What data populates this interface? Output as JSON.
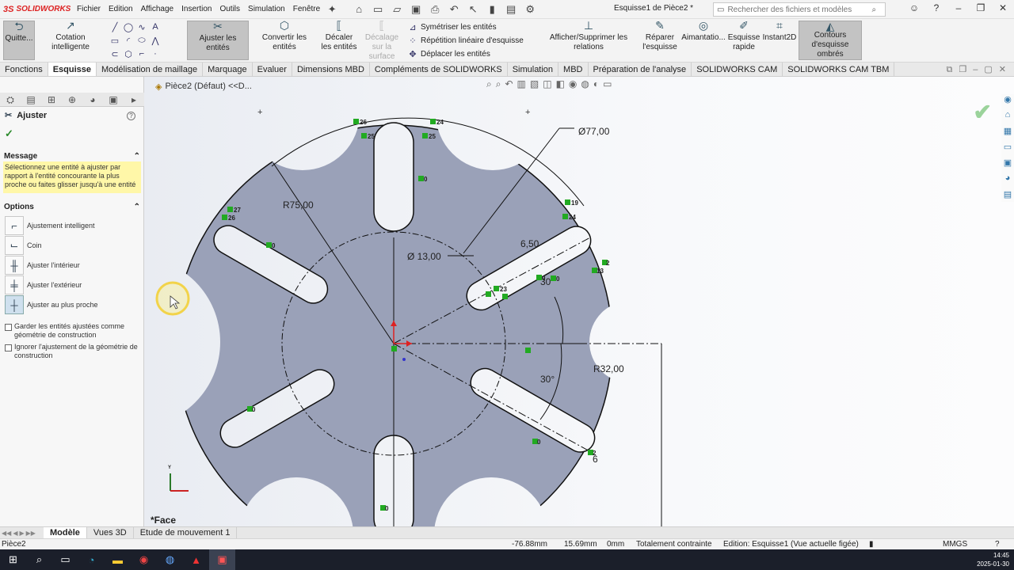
{
  "app": {
    "logo_text": "SOLIDWORKS",
    "menu": [
      "Fichier",
      "Edition",
      "Affichage",
      "Insertion",
      "Outils",
      "Simulation",
      "Fenêtre"
    ],
    "document_title": "Esquisse1 de Pièce2 *",
    "search_placeholder": "Rechercher des fichiers et modèles"
  },
  "ribbon": {
    "quit_label": "Quitte...",
    "smart_dim_label": "Cotation intelligente",
    "trim_label": "Ajuster les entités",
    "convert_label": "Convertir les entités",
    "offset_label": "Décaler les entités",
    "offset_surface_label": "Décalage sur la surface",
    "mirror_label": "Symétriser les entités",
    "linear_pattern_label": "Répétition linéaire d'esquisse",
    "move_label": "Déplacer les entités",
    "relations_label": "Afficher/Supprimer les relations",
    "repair_label": "Réparer l'esquisse",
    "snap_label": "Aimantatio...",
    "quick_sketch_label": "Esquisse rapide",
    "instant2d_label": "Instant2D",
    "shaded_contours_label": "Contours d'esquisse ombrés"
  },
  "tabs": [
    {
      "label": "Fonctions",
      "active": false
    },
    {
      "label": "Esquisse",
      "active": true
    },
    {
      "label": "Modélisation de maillage",
      "active": false
    },
    {
      "label": "Marquage",
      "active": false
    },
    {
      "label": "Evaluer",
      "active": false
    },
    {
      "label": "Dimensions MBD",
      "active": false
    },
    {
      "label": "Compléments de SOLIDWORKS",
      "active": false
    },
    {
      "label": "Simulation",
      "active": false
    },
    {
      "label": "MBD",
      "active": false
    },
    {
      "label": "Préparation de l'analyse",
      "active": false
    },
    {
      "label": "SOLIDWORKS CAM",
      "active": false
    },
    {
      "label": "SOLIDWORKS CAM TBM",
      "active": false
    }
  ],
  "property_manager": {
    "title": "Ajuster",
    "message_header": "Message",
    "message_text": "Sélectionnez une entité à ajuster par rapport à l'entité concourante la plus proche ou faites glisser jusqu'à une entité",
    "options_header": "Options",
    "options": [
      {
        "label": "Ajustement intelligent",
        "icon": "smart-trim-icon",
        "selected": false
      },
      {
        "label": "Coin",
        "icon": "corner-icon",
        "selected": false
      },
      {
        "label": "Ajuster l'intérieur",
        "icon": "trim-inside-icon",
        "selected": false
      },
      {
        "label": "Ajuster l'extérieur",
        "icon": "trim-outside-icon",
        "selected": false
      },
      {
        "label": "Ajuster au plus proche",
        "icon": "trim-closest-icon",
        "selected": true
      }
    ],
    "checkbox_keep_construction": "Garder les entités ajustées comme géométrie de construction",
    "checkbox_ignore_trim": "Ignorer l'ajustement de la géométrie de construction"
  },
  "viewport": {
    "breadcrumb": "Pièce2 (Défaut) <<D...",
    "face_label": "*Face",
    "dimensions": {
      "dia_outer": "Ø77,00",
      "r75": "R75,00",
      "dia_slot": "Ø 13,00",
      "width": "6,50",
      "angle_top": "30",
      "angle_bottom": "30°",
      "r32": "R32,00",
      "six": "6"
    },
    "relation_tags": [
      "26",
      "24",
      "25",
      "25",
      "0",
      "27",
      "26",
      "0",
      "19",
      "24",
      "2",
      "13",
      "23",
      "0",
      "0",
      "0",
      "0",
      "2",
      "0"
    ]
  },
  "bottom_tabs": [
    {
      "label": "Modèle",
      "active": true
    },
    {
      "label": "Vues 3D",
      "active": false
    },
    {
      "label": "Etude de mouvement 1",
      "active": false
    }
  ],
  "status": {
    "part_name": "Pièce2",
    "x": "-76.88mm",
    "y": "15.69mm",
    "z": "0mm",
    "constraint": "Totalement contrainte",
    "edition": "Edition: Esquisse1 (Vue actuelle figée)",
    "units": "MMGS"
  },
  "taskbar": {
    "time": "14:45",
    "date": "2025-01-30"
  }
}
